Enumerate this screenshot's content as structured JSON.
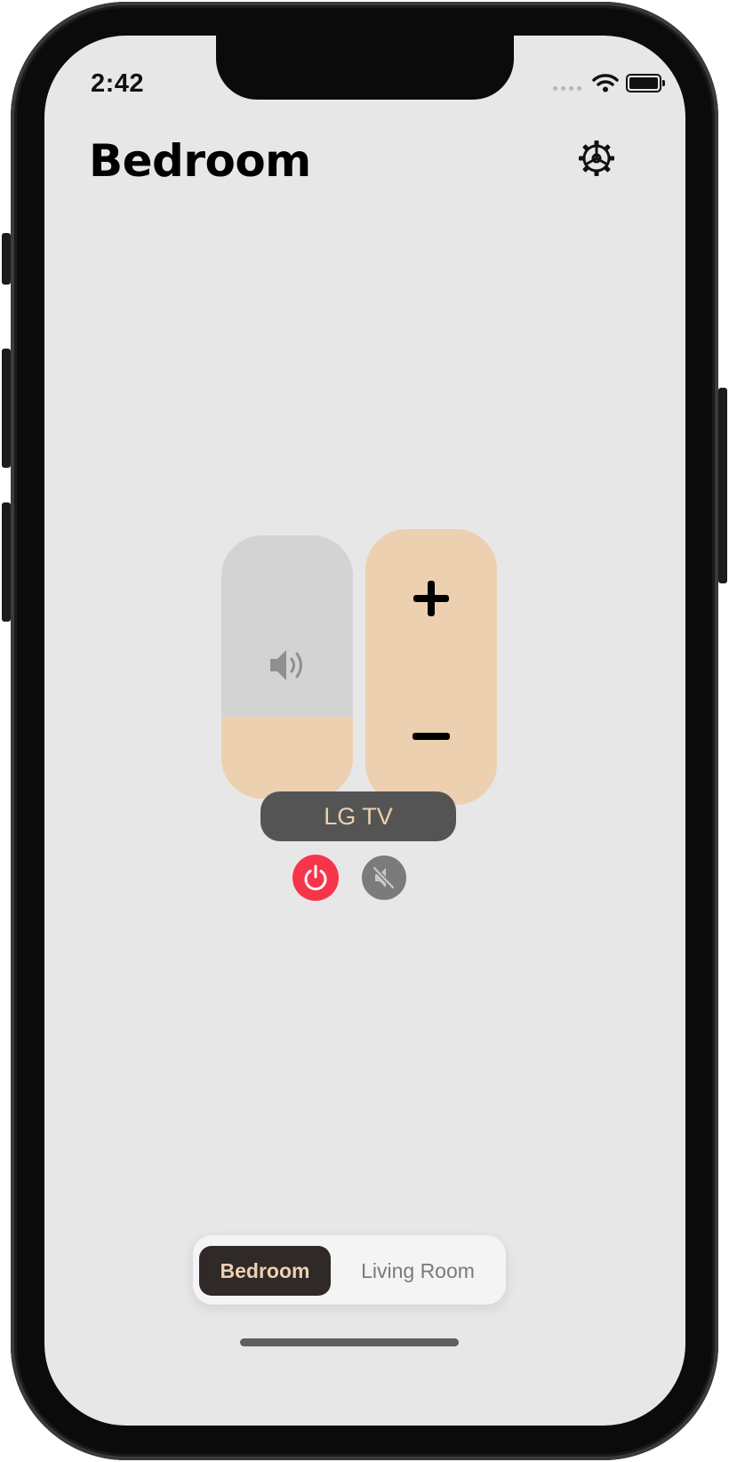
{
  "status_bar": {
    "time": "2:42"
  },
  "header": {
    "title": "Bedroom",
    "settings_icon": "gear-icon"
  },
  "volume": {
    "level_fraction": 0.31,
    "icon": "speaker-icon",
    "increase_icon": "plus-icon",
    "decrease_icon": "minus-icon"
  },
  "device": {
    "name": "LG TV",
    "power_icon": "power-icon",
    "mute_icon": "mute-icon"
  },
  "rooms": {
    "tabs": [
      {
        "label": "Bedroom",
        "selected": true
      },
      {
        "label": "Living Room",
        "selected": false
      }
    ]
  },
  "colors": {
    "accent": "#edd0b0",
    "power": "#f7354a",
    "background": "#e8e7e8",
    "pill": "#555454"
  }
}
